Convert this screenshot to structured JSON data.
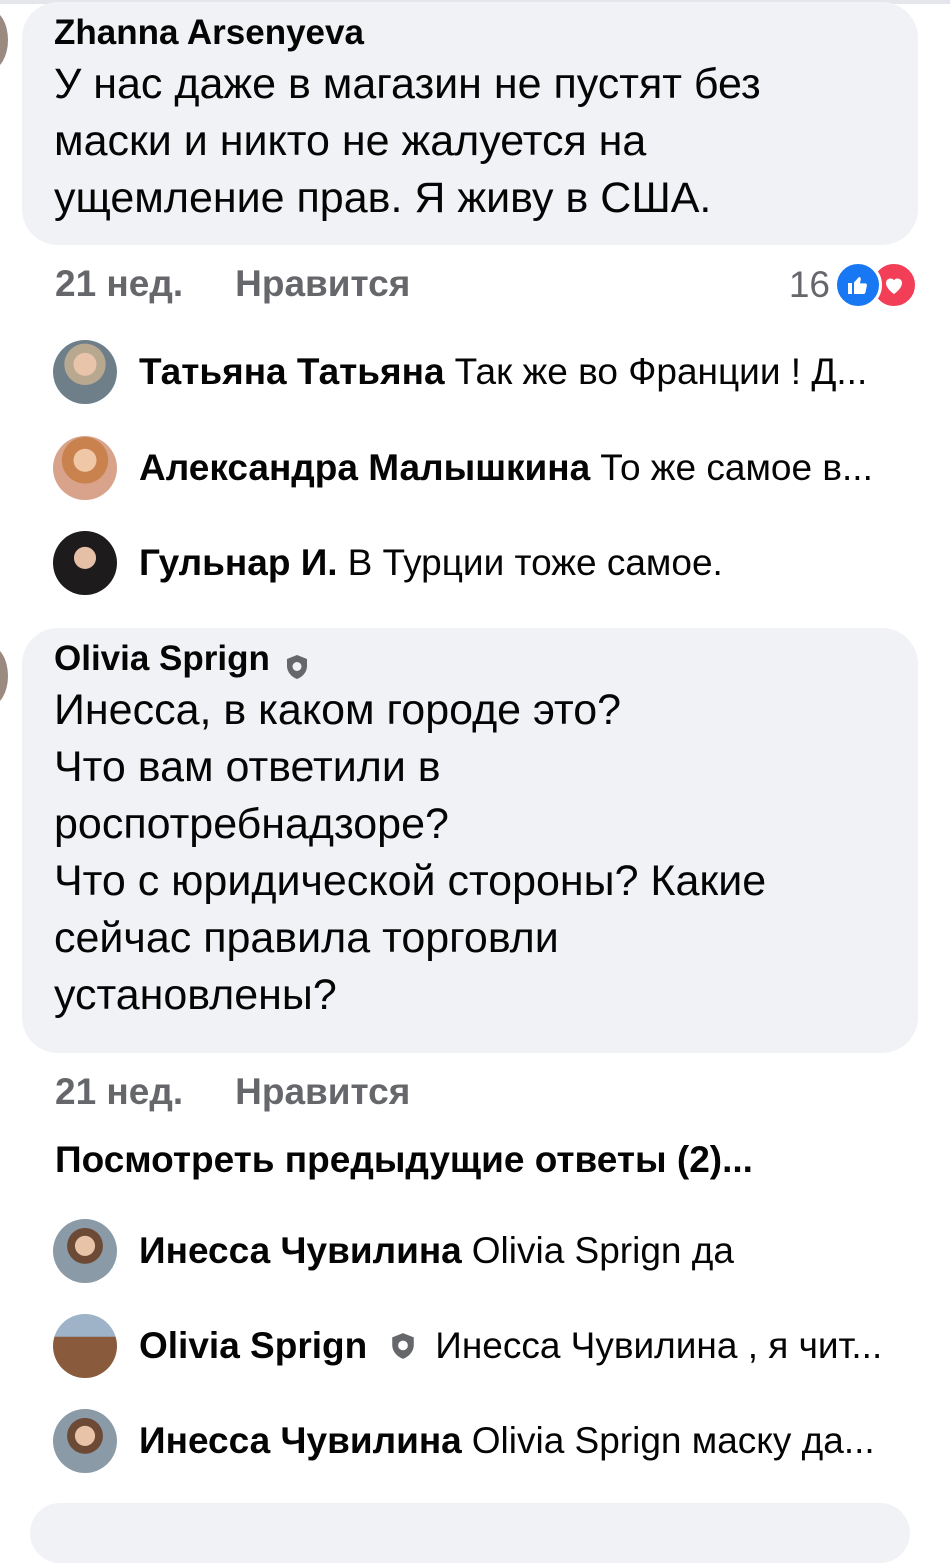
{
  "comments": [
    {
      "author": "Zhanna Arsenyeva",
      "text": "У нас даже в магазин не пустят без\nмаски и никто не жалуется на\nущемление прав. Я живу в США.",
      "time": "21 нед.",
      "like_label": "Нравится",
      "reaction_count": "16",
      "replies": [
        {
          "name": "Татьяна Татьяна",
          "text": "Так же во Франции ! Д..."
        },
        {
          "name": "Александра Малышкина",
          "text": "То же самое в..."
        },
        {
          "name": "Гульнар И.",
          "text": "В Турции тоже самое."
        }
      ]
    },
    {
      "author": "Olivia Sprign",
      "text": "Инесса, в каком городе это?\nЧто вам ответили в\nроспотребнадзоре?\nЧто с юридической стороны? Какие\nсейчас правила торговли\nустановлены?",
      "time": "21 нед.",
      "like_label": "Нравится",
      "view_previous": "Посмотреть предыдущие ответы (2)...",
      "replies": [
        {
          "name": "Инесса Чувилина",
          "text": "Olivia Sprign да"
        },
        {
          "name": "Olivia Sprign",
          "text": "Инесса Чувилина , я чит..."
        },
        {
          "name": "Инесса Чувилина",
          "text": "Olivia Sprign маску да..."
        }
      ]
    }
  ],
  "colors": {
    "bubble": "#f0f2f5",
    "meta_text": "#65676b",
    "like_blue": "#1877f2",
    "love_red": "#f33e58"
  }
}
